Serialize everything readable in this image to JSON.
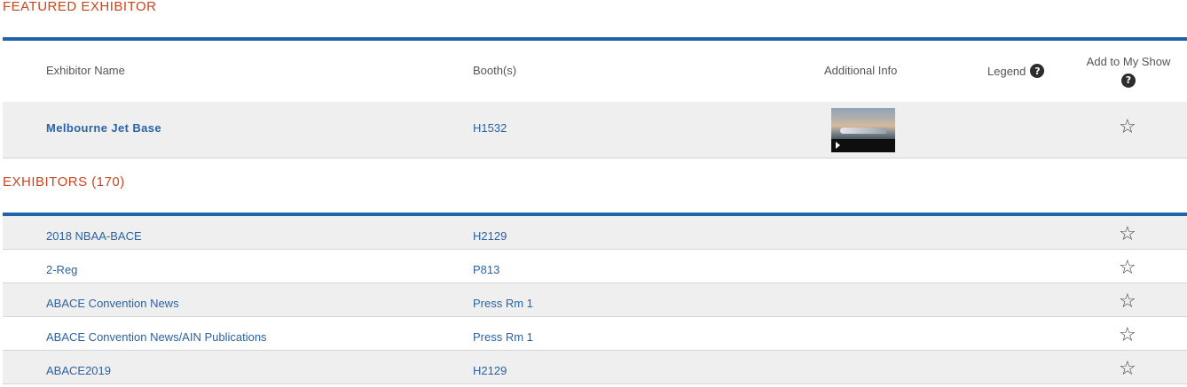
{
  "featured": {
    "section_title": "FEATURED EXHIBITOR",
    "headers": {
      "name": "Exhibitor Name",
      "booth": "Booth(s)",
      "info": "Additional Info",
      "legend": "Legend",
      "add": "Add to My Show",
      "help_symbol": "?"
    },
    "row": {
      "name": "Melbourne Jet Base",
      "booth": "H1532",
      "star": "☆"
    }
  },
  "exhibitors": {
    "section_title": "EXHIBITORS (170)",
    "rows": [
      {
        "name": "2018 NBAA-BACE",
        "booth": "H2129",
        "star": "☆"
      },
      {
        "name": "2-Reg",
        "booth": "P813",
        "star": "☆"
      },
      {
        "name": "ABACE Convention News",
        "booth": "Press Rm 1",
        "star": "☆"
      },
      {
        "name": "ABACE Convention News/AIN Publications",
        "booth": "Press Rm 1",
        "star": "☆"
      },
      {
        "name": "ABACE2019",
        "booth": "H2129",
        "star": "☆"
      }
    ]
  },
  "colors": {
    "section_title": "#c8461e",
    "accent_rule": "#1f64a8",
    "link": "#2b63a4",
    "row_shade": "#efefef"
  },
  "icons": {
    "help": "question-circle-icon",
    "star": "star-outline-icon",
    "play": "play-icon"
  }
}
